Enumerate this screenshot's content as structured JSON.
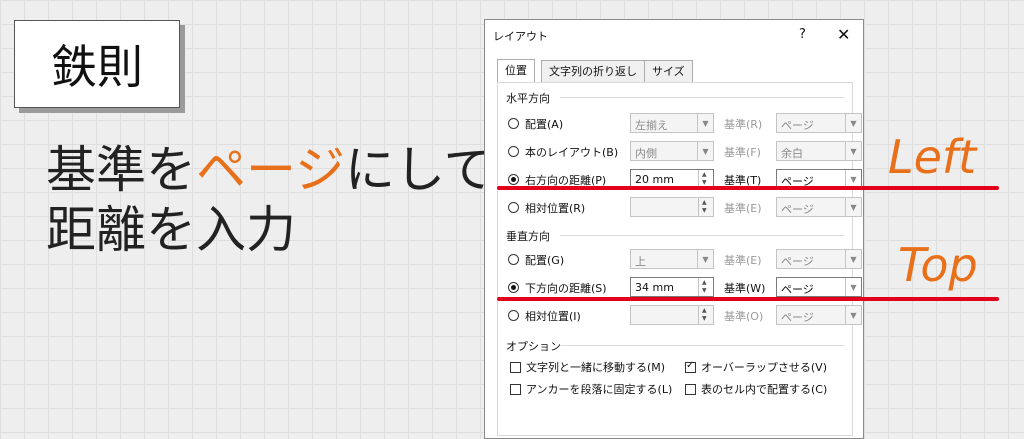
{
  "slide": {
    "title": "鉄則",
    "headline_line1_pre": "基準を",
    "headline_line1_accent": "ページ",
    "headline_line1_post": "にして",
    "headline_line2": "距離を入力",
    "annotation_left": "Left",
    "annotation_top": "Top",
    "accent_color": "#e8701a",
    "line_color": "#e2001a"
  },
  "dialog": {
    "title": "レイアウト",
    "help": "?",
    "close": "✕",
    "tabs": [
      "位置",
      "文字列の折り返し",
      "サイズ"
    ],
    "horizontal": {
      "label": "水平方向",
      "rows": [
        {
          "label": "配置(A)",
          "value": "左揃え",
          "base_label": "基準(R)",
          "base_value": "ページ"
        },
        {
          "label": "本のレイアウト(B)",
          "value": "内側",
          "base_label": "基準(F)",
          "base_value": "余白"
        },
        {
          "label": "右方向の距離(P)",
          "value": "20 mm",
          "base_label": "基準(T)",
          "base_value": "ページ"
        },
        {
          "label": "相対位置(R)",
          "value": "",
          "base_label": "基準(E)",
          "base_value": "ページ"
        }
      ]
    },
    "vertical": {
      "label": "垂直方向",
      "rows": [
        {
          "label": "配置(G)",
          "value": "上",
          "base_label": "基準(E)",
          "base_value": "ページ"
        },
        {
          "label": "下方向の距離(S)",
          "value": "34 mm",
          "base_label": "基準(W)",
          "base_value": "ページ"
        },
        {
          "label": "相対位置(I)",
          "value": "",
          "base_label": "基準(O)",
          "base_value": "ページ"
        }
      ]
    },
    "options": {
      "label": "オプション",
      "items": [
        {
          "label": "文字列と一緒に移動する(M)",
          "checked": false
        },
        {
          "label": "オーバーラップさせる(V)",
          "checked": true
        },
        {
          "label": "アンカーを段落に固定する(L)",
          "checked": false
        },
        {
          "label": "表のセル内で配置する(C)",
          "checked": false
        }
      ]
    }
  }
}
